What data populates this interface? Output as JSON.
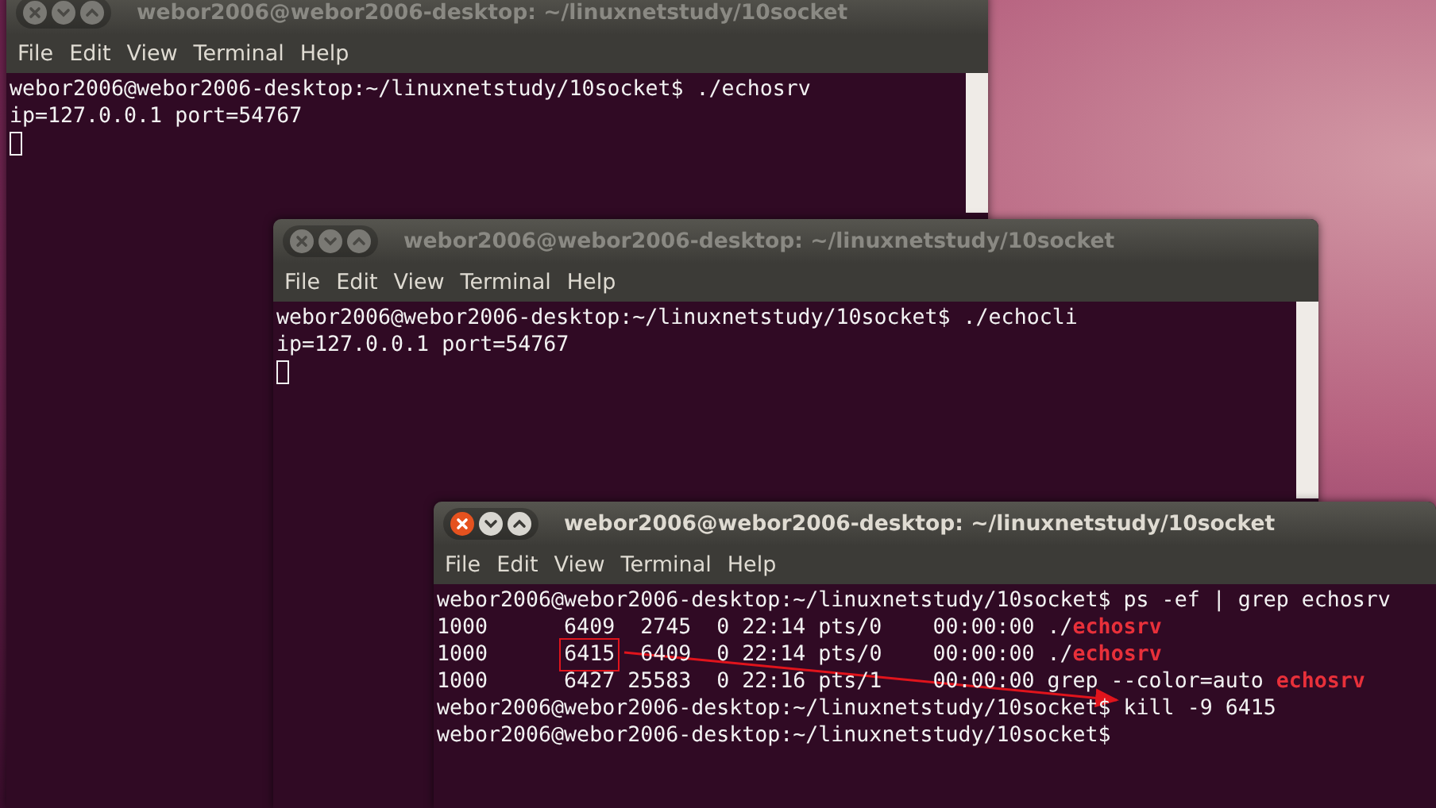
{
  "windows": [
    {
      "title": "webor2006@webor2006-desktop: ~/linuxnetstudy/10socket",
      "focused": false,
      "menu": [
        "File",
        "Edit",
        "View",
        "Terminal",
        "Help"
      ],
      "cursor": true,
      "lines": [
        {
          "segments": [
            {
              "text": "webor2006@webor2006-desktop:~/linuxnetstudy/10socket$ ./echosrv",
              "match": false
            }
          ]
        },
        {
          "segments": [
            {
              "text": "ip=127.0.0.1 port=54767",
              "match": false
            }
          ]
        }
      ]
    },
    {
      "title": "webor2006@webor2006-desktop: ~/linuxnetstudy/10socket",
      "focused": false,
      "menu": [
        "File",
        "Edit",
        "View",
        "Terminal",
        "Help"
      ],
      "cursor": true,
      "lines": [
        {
          "segments": [
            {
              "text": "webor2006@webor2006-desktop:~/linuxnetstudy/10socket$ ./echocli",
              "match": false
            }
          ]
        },
        {
          "segments": [
            {
              "text": "ip=127.0.0.1 port=54767",
              "match": false
            }
          ]
        }
      ]
    },
    {
      "title": "webor2006@webor2006-desktop: ~/linuxnetstudy/10socket",
      "focused": true,
      "menu": [
        "File",
        "Edit",
        "View",
        "Terminal",
        "Help"
      ],
      "cursor": false,
      "lines": [
        {
          "segments": [
            {
              "text": "webor2006@webor2006-desktop:~/linuxnetstudy/10socket$ ps -ef | grep echosrv",
              "match": false
            }
          ]
        },
        {
          "segments": [
            {
              "text": "1000      6409  2745  0 22:14 pts/0    00:00:00 ./",
              "match": false
            },
            {
              "text": "echosrv",
              "match": true
            }
          ]
        },
        {
          "segments": [
            {
              "text": "1000      ",
              "match": false
            },
            {
              "text": "6415",
              "match": false,
              "boxed": true
            },
            {
              "text": "  6409  0 22:14 pts/0    00:00:00 ./",
              "match": false
            },
            {
              "text": "echosrv",
              "match": true
            }
          ]
        },
        {
          "segments": [
            {
              "text": "1000      6427 25583  0 22:16 pts/1    00:00:00 grep --color=auto ",
              "match": false
            },
            {
              "text": "echosrv",
              "match": true
            }
          ]
        },
        {
          "segments": [
            {
              "text": "webor2006@webor2006-desktop:~/linuxnetstudy/10socket$ kill -9 6415",
              "match": false
            }
          ]
        },
        {
          "segments": [
            {
              "text": "webor2006@webor2006-desktop:~/linuxnetstudy/10socket$",
              "match": false
            }
          ]
        }
      ]
    }
  ]
}
